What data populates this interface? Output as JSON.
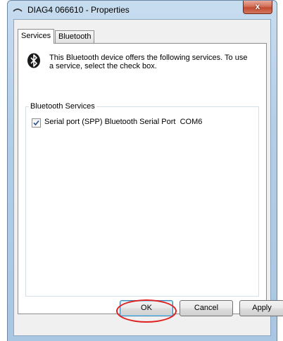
{
  "window": {
    "title": "DIAG4 066610 - Properties",
    "close_label": "x"
  },
  "tabs": [
    {
      "label": "Services",
      "selected": true
    },
    {
      "label": "Bluetooth",
      "selected": false
    }
  ],
  "services_tab": {
    "description": "This Bluetooth device offers the following services. To use a service, select the check box.",
    "group_title": "Bluetooth Services",
    "services": [
      {
        "label": "Serial port (SPP) Bluetooth Serial Port  COM6",
        "checked": true
      }
    ]
  },
  "buttons": {
    "ok": "OK",
    "cancel": "Cancel",
    "apply": "Apply"
  },
  "colors": {
    "highlight_oval": "#e02020",
    "bluetooth_icon": "#1a1a1a"
  }
}
